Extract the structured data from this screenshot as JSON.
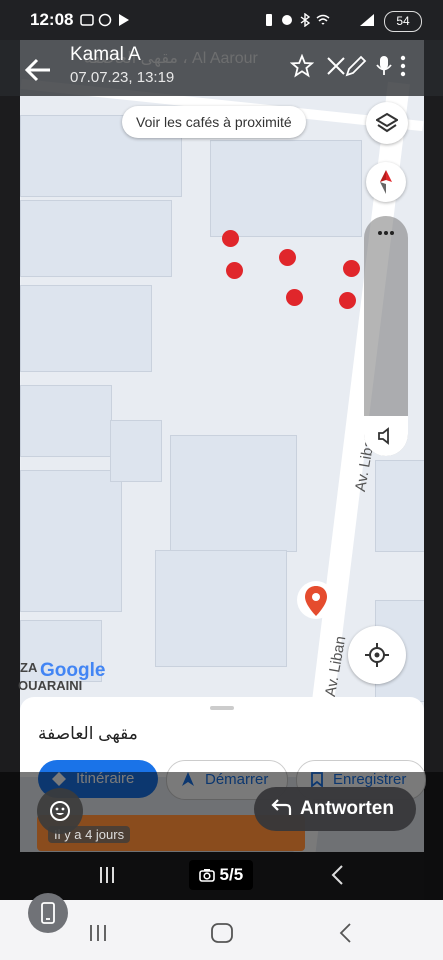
{
  "status_bar": {
    "time": "12:08",
    "battery": "54"
  },
  "header": {
    "contact_name": "Kamal A",
    "timestamp": "07.07.23, 13:19",
    "underlying_title": "مقهى العاصفة ، Al Aarour"
  },
  "map": {
    "nearby_button": "Voir les cafés à proximité",
    "road_label_1": "Av. Liban",
    "road_label_2": "Av. Liban",
    "google_logo": "Google",
    "area_label_1": "ZA",
    "area_label_2": "OUARAINI",
    "pin_count": 7
  },
  "bottom_sheet": {
    "place_name": "مقهى العاصفة",
    "directions_label": "Itinéraire",
    "start_label": "Démarrer",
    "save_label": "Enregistrer"
  },
  "reply": {
    "label": "Antworten"
  },
  "story": {
    "posted_ago": "Il y a 4 jours"
  },
  "viewer": {
    "counter": "5/5"
  },
  "colors": {
    "accent_blue": "#1a73e8",
    "pin_red": "#e0262b"
  }
}
